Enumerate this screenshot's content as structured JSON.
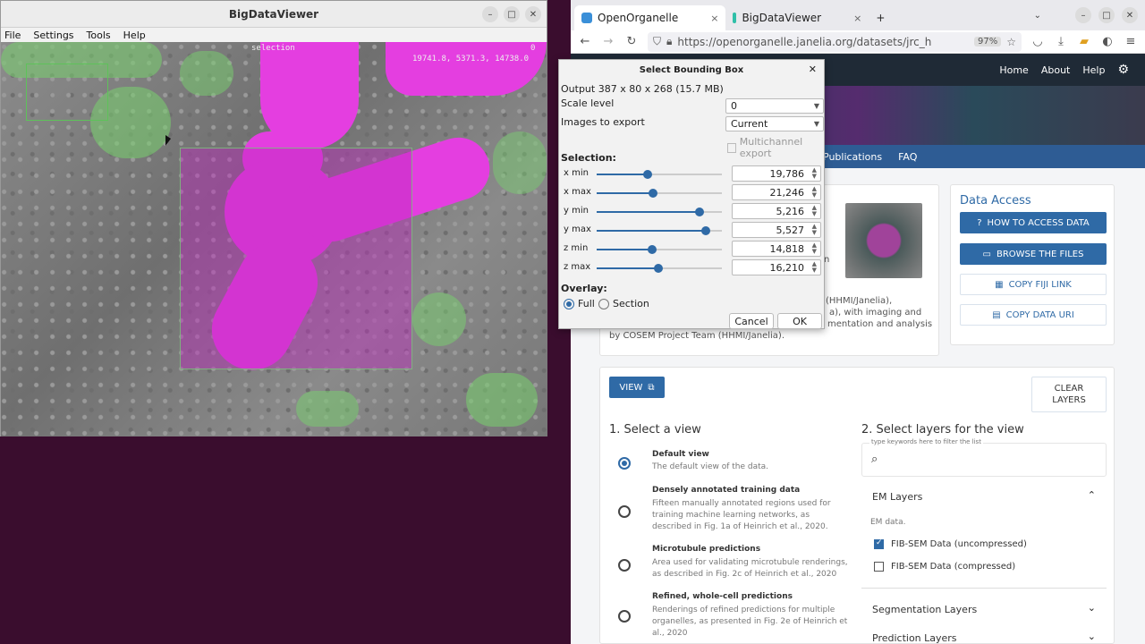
{
  "bdv": {
    "title": "BigDataViewer",
    "menu": [
      "File",
      "Settings",
      "Tools",
      "Help"
    ],
    "viewer_label_top": "selection",
    "viewer_coords": "19741.8, 5371.3, 14738.0",
    "viewer_zero": "0"
  },
  "browser": {
    "tabs": [
      {
        "label": "OpenOrganelle",
        "close": "×"
      },
      {
        "label": "BigDataViewer",
        "close": "×"
      }
    ],
    "new_tab": "+",
    "url": "https://openorganelle.janelia.org/datasets/jrc_h",
    "zoom": "97%",
    "header_links": [
      "Home",
      "About",
      "Help"
    ],
    "subnav": [
      "Publications",
      "FAQ"
    ]
  },
  "data_access": {
    "title": "Data Access",
    "how_to": "HOW TO ACCESS DATA",
    "browse": "BROWSE THE FILES",
    "copy_fiji": "COPY FIJI LINK",
    "copy_uri": "COPY DATA URI"
  },
  "dataset_desc": {
    "line1": "(HHMI/Janelia),",
    "line2": "a), with imaging and",
    "line3": "mentation and analysis",
    "line4": "by COSEM Project Team (HHMI/Janelia).",
    "frag": "n"
  },
  "view_panel": {
    "view_button": "VIEW",
    "clear_layers": [
      "CLEAR",
      "LAYERS"
    ],
    "select_view_title": "1. Select a view",
    "views": [
      {
        "title": "Default view",
        "desc": "The default view of the data.",
        "selected": true
      },
      {
        "title": "Densely annotated training data",
        "desc": "Fifteen manually annotated regions used for training machine learning networks, as described in Fig. 1a of Heinrich et al., 2020.",
        "selected": false
      },
      {
        "title": "Microtubule predictions",
        "desc": "Area used for validating microtubule renderings, as described in Fig. 2c of Heinrich et al., 2020",
        "selected": false
      },
      {
        "title": "Refined, whole-cell predictions",
        "desc": "Renderings of refined predictions for multiple organelles, as presented in Fig. 2e of Heinrich et al., 2020",
        "selected": false
      }
    ],
    "select_layers_title": "2. Select layers for the view",
    "filter_hint": "type keywords here to filter the list",
    "em_layers": "EM Layers",
    "em_data": "EM data.",
    "layers": [
      {
        "label": "FIB-SEM Data (uncompressed)",
        "checked": true
      },
      {
        "label": "FIB-SEM Data (compressed)",
        "checked": false
      }
    ],
    "segmentation_layers": "Segmentation Layers",
    "prediction_layers": "Prediction Layers"
  },
  "dialog": {
    "title": "Select Bounding Box",
    "output": "Output 387 x 80 x 268 (15.7 MB)",
    "scale_level_label": "Scale level",
    "scale_level_value": "0",
    "images_label": "Images to export",
    "images_value": "Current",
    "multichannel": "Multichannel export",
    "selection_label": "Selection:",
    "sliders": [
      {
        "label": "x min",
        "value": "19,786",
        "pos": 0.41
      },
      {
        "label": "x max",
        "value": "21,246",
        "pos": 0.45
      },
      {
        "label": "y min",
        "value": "5,216",
        "pos": 0.82
      },
      {
        "label": "y max",
        "value": "5,527",
        "pos": 0.87
      },
      {
        "label": "z min",
        "value": "14,818",
        "pos": 0.44
      },
      {
        "label": "z max",
        "value": "16,210",
        "pos": 0.49
      }
    ],
    "overlay_label": "Overlay:",
    "overlay_full": "Full",
    "overlay_section": "Section",
    "cancel": "Cancel",
    "ok": "OK"
  }
}
